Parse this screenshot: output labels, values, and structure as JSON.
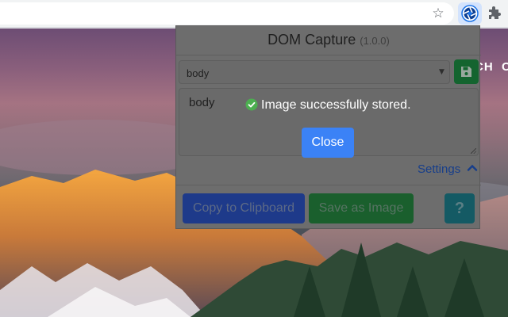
{
  "browser": {
    "star_icon": "star-icon",
    "active_extension_icon": "aperture-icon",
    "extensions_icon": "puzzle-icon"
  },
  "page": {
    "nav_label": "CH",
    "nav_label2": "C"
  },
  "popup": {
    "title": "DOM Capture",
    "version": "(1.0.0)",
    "selector_value": "body",
    "editor_text": "body",
    "settings_label": "Settings",
    "buttons": {
      "copy": "Copy to Clipboard",
      "save_image": "Save as Image",
      "help": "?"
    }
  },
  "notification": {
    "message": "Image successfully stored.",
    "close_label": "Close",
    "icon": "check-circle-icon"
  },
  "colors": {
    "primary": "#3b82f6",
    "success": "#4caf50",
    "save_green": "#14642f"
  }
}
